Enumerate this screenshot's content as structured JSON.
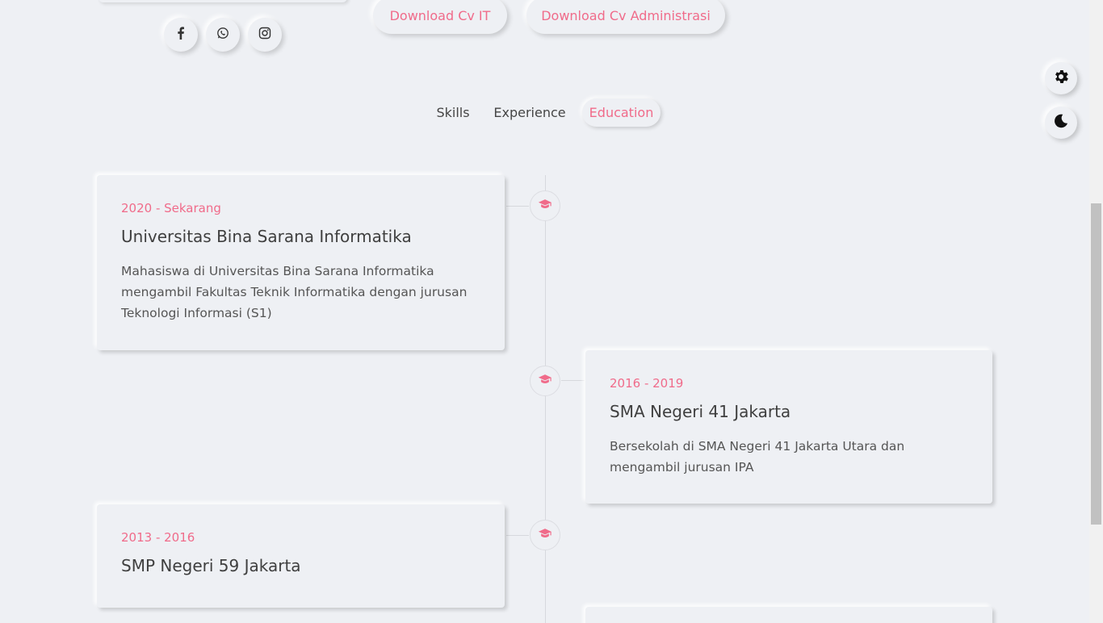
{
  "profile": {
    "social": [
      {
        "name": "facebook-icon"
      },
      {
        "name": "whatsapp-icon"
      },
      {
        "name": "instagram-icon"
      }
    ],
    "download_cv_it": "Download Cv IT",
    "download_cv_admin": "Download Cv Administrasi"
  },
  "tabs": [
    {
      "label": "Skills"
    },
    {
      "label": "Experience"
    },
    {
      "label": "Education",
      "active": true
    }
  ],
  "settings": {
    "gear_icon": "gear-icon",
    "theme_icon": "moon-icon"
  },
  "education": [
    {
      "period": "2020 - Sekarang",
      "school": "Universitas Bina Sarana Informatika",
      "description": "Mahasiswa di Universitas Bina Sarana Informatika mengambil Fakultas Teknik Informatika dengan jurusan Teknologi Informasi (S1)",
      "icon": "graduation-cap-icon"
    },
    {
      "period": "2016 - 2019",
      "school": "SMA Negeri 41 Jakarta",
      "description": "Bersekolah di SMA Negeri 41 Jakarta Utara dan mengambil jurusan IPA",
      "icon": "graduation-cap-icon"
    },
    {
      "period": "2013 - 2016",
      "school": "SMP Negeri 59 Jakarta",
      "description": "",
      "icon": "graduation-cap-icon"
    }
  ],
  "colors": {
    "accent": "#f06b8a",
    "background": "#eef0f4",
    "text": "#444444"
  }
}
